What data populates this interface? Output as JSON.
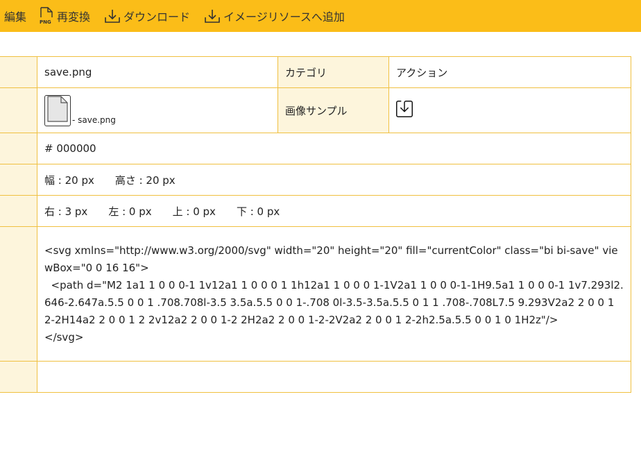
{
  "toolbar": {
    "edit_label": "編集",
    "reconvert_label": "再変換",
    "download_label": "ダウンロード",
    "add_resource_label": "イメージリソースへ追加"
  },
  "file": {
    "name": "save.png",
    "thumb_caption": "- save.png",
    "category_label": "カテゴリ",
    "category_value": "アクション",
    "sample_label": "画像サンプル",
    "color": "# 000000",
    "width_text": "幅 : 20 px",
    "height_text": "高さ : 20 px",
    "right_text": "右 : 3 px",
    "left_text": "左 : 0 px",
    "top_text": "上 : 0 px",
    "bottom_text": "下 : 0 px",
    "svg_source": "<svg xmlns=\"http://www.w3.org/2000/svg\" width=\"20\" height=\"20\" fill=\"currentColor\" class=\"bi bi-save\" viewBox=\"0 0 16 16\">\n  <path d=\"M2 1a1 1 0 0 0-1 1v12a1 1 0 0 0 1 1h12a1 1 0 0 0 1-1V2a1 1 0 0 0-1-1H9.5a1 1 0 0 0-1 1v7.293l2.646-2.647a.5.5 0 0 1 .708.708l-3.5 3.5a.5.5 0 0 1-.708 0l-3.5-3.5a.5.5 0 1 1 .708-.708L7.5 9.293V2a2 2 0 0 1 2-2H14a2 2 0 0 1 2 2v12a2 2 0 0 1-2 2H2a2 2 0 0 1-2-2V2a2 2 0 0 1 2-2h2.5a.5.5 0 0 1 0 1H2z\"/>\n</svg>"
  },
  "colors": {
    "toolbar_bg": "#fbbd18",
    "border": "#f0c040",
    "label_bg": "#fdf5dc"
  }
}
